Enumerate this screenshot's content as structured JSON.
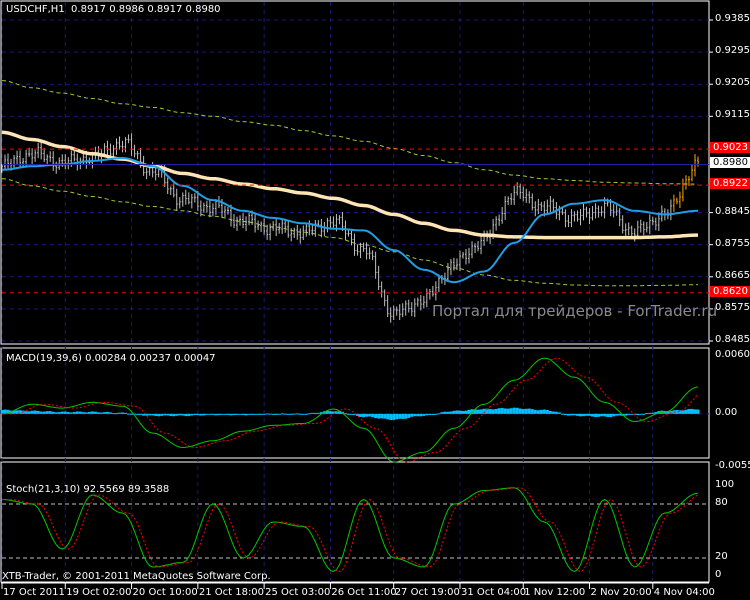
{
  "window": {
    "title": "USDCHF,H1",
    "ohlc": "0.8917 0.8986 0.8917 0.8980"
  },
  "watermark": "Портал для трейдеров - ForTrader.ru",
  "copyright": "XTB-Trader, © 2001-2011 MetaQuotes Software Corp.",
  "colors": {
    "bg": "#000000",
    "grid": "#1a1a7a",
    "bars": "#c0c0c0",
    "last_bars": "#ffa500",
    "ma_slow": "#ffe4b5",
    "ma_fast": "#1e9fe6",
    "bands": "#9acd32",
    "macd_main": "#00c800",
    "macd_signal": "#ff0000",
    "macd_hist": "#00bfff",
    "stoch_main": "#00c800",
    "stoch_signal": "#ff0000",
    "level": "#c0c0c0",
    "alert": "#ff0000"
  },
  "chart_data": [
    {
      "type": "line",
      "title": "USDCHF,H1",
      "bar_count": 232,
      "ylim": [
        0.844,
        0.943
      ],
      "y_ticks": [
        "0.9385",
        "0.9295",
        "0.9205",
        "0.9115",
        "0.8845",
        "0.8755",
        "0.8665",
        "0.8575",
        "0.8485"
      ],
      "price_labels": [
        {
          "text": "0.9023",
          "kind": "alert",
          "value": 0.9023
        },
        {
          "text": "0.8922",
          "kind": "alert",
          "value": 0.8922
        },
        {
          "text": "0.8620",
          "kind": "alert",
          "value": 0.862
        },
        {
          "text": "0.8980",
          "kind": "current",
          "value": 0.898
        }
      ],
      "x_ticks": [
        {
          "bar": 0,
          "label": "17 Oct 2011"
        },
        {
          "bar": 21,
          "label": "19 Oct 02:00"
        },
        {
          "bar": 43,
          "label": "20 Oct 10:00"
        },
        {
          "bar": 65,
          "label": "21 Oct 18:00"
        },
        {
          "bar": 87,
          "label": "25 Oct 03:00"
        },
        {
          "bar": 109,
          "label": "26 Oct 11:00"
        },
        {
          "bar": 130,
          "label": "27 Oct 19:00"
        },
        {
          "bar": 152,
          "label": "31 Oct 04:00"
        },
        {
          "bar": 173,
          "label": "1 Nov 12:00"
        },
        {
          "bar": 195,
          "label": "2 Nov 20:00"
        },
        {
          "bar": 216,
          "label": "4 Nov 04:00"
        }
      ],
      "key_bars": [
        0,
        10,
        20,
        30,
        40,
        50,
        60,
        70,
        80,
        90,
        100,
        110,
        120,
        130,
        140,
        150,
        160,
        170,
        180,
        190,
        200,
        210,
        220,
        231
      ],
      "series": [
        {
          "name": "close",
          "values": [
            0.8975,
            0.901,
            0.8985,
            0.9,
            0.904,
            0.896,
            0.888,
            0.886,
            0.882,
            0.88,
            0.879,
            0.882,
            0.874,
            0.856,
            0.86,
            0.87,
            0.877,
            0.89,
            0.886,
            0.883,
            0.886,
            0.879,
            0.884,
            0.898
          ]
        },
        {
          "name": "ma_slow",
          "values": [
            0.907,
            0.905,
            0.903,
            0.901,
            0.8995,
            0.8975,
            0.8955,
            0.894,
            0.8925,
            0.8912,
            0.89,
            0.8885,
            0.8865,
            0.884,
            0.8815,
            0.8795,
            0.8782,
            0.8777,
            0.8775,
            0.8775,
            0.8775,
            0.8775,
            0.8777,
            0.8782
          ]
        },
        {
          "name": "ma_fast",
          "values": [
            0.8965,
            0.8975,
            0.898,
            0.899,
            0.8998,
            0.8975,
            0.892,
            0.888,
            0.885,
            0.883,
            0.8815,
            0.88,
            0.8795,
            0.874,
            0.8685,
            0.865,
            0.868,
            0.876,
            0.884,
            0.887,
            0.888,
            0.885,
            0.884,
            0.885
          ]
        },
        {
          "name": "band_upper",
          "values": [
            0.9215,
            0.9195,
            0.918,
            0.9165,
            0.915,
            0.914,
            0.9125,
            0.9115,
            0.91,
            0.909,
            0.9075,
            0.906,
            0.9045,
            0.9025,
            0.9005,
            0.8985,
            0.8965,
            0.895,
            0.894,
            0.8935,
            0.893,
            0.8928,
            0.8926,
            0.8925
          ]
        },
        {
          "name": "band_lower",
          "values": [
            0.894,
            0.892,
            0.8905,
            0.889,
            0.8875,
            0.8862,
            0.885,
            0.8835,
            0.882,
            0.8805,
            0.879,
            0.8775,
            0.8755,
            0.8735,
            0.8712,
            0.869,
            0.867,
            0.8655,
            0.8647,
            0.8642,
            0.864,
            0.864,
            0.8641,
            0.8643
          ]
        }
      ]
    },
    {
      "type": "line",
      "title": "MACD(19,39,6) 0.00284 0.00237 0.00047",
      "ylim": [
        -0.00553,
        0.00602
      ],
      "y_ticks": [
        "0.00602",
        "0.00",
        "-0.00553"
      ],
      "main": [
        0.0,
        0.001,
        0.0006,
        0.0012,
        0.0008,
        -0.002,
        -0.0035,
        -0.0028,
        -0.0018,
        -0.0012,
        -0.001,
        0.0005,
        -0.0015,
        -0.005,
        -0.004,
        -0.0015,
        0.001,
        0.0035,
        0.0058,
        0.0038,
        0.0012,
        -0.0008,
        0.0002,
        0.0028
      ],
      "hist": [
        0.0004,
        0.0003,
        0.0002,
        0.0002,
        0.0001,
        -0.0002,
        -0.0002,
        -0.0001,
        -0.0001,
        0.0,
        0.0,
        0.0003,
        -0.0003,
        -0.0006,
        -0.0002,
        0.0003,
        0.0005,
        0.0006,
        0.0004,
        -0.0002,
        -0.0003,
        -0.0001,
        0.0003,
        0.0005
      ]
    },
    {
      "type": "line",
      "title": "Stoch(21,3,10) 92.5569 89.3588",
      "ylim": [
        0,
        100
      ],
      "y_ticks": [
        "100",
        "80",
        "20",
        "0"
      ],
      "levels": [
        80,
        20
      ],
      "main": [
        85,
        80,
        30,
        90,
        70,
        10,
        15,
        80,
        20,
        60,
        55,
        5,
        85,
        20,
        10,
        80,
        95,
        98,
        60,
        5,
        85,
        10,
        70,
        92
      ]
    }
  ]
}
